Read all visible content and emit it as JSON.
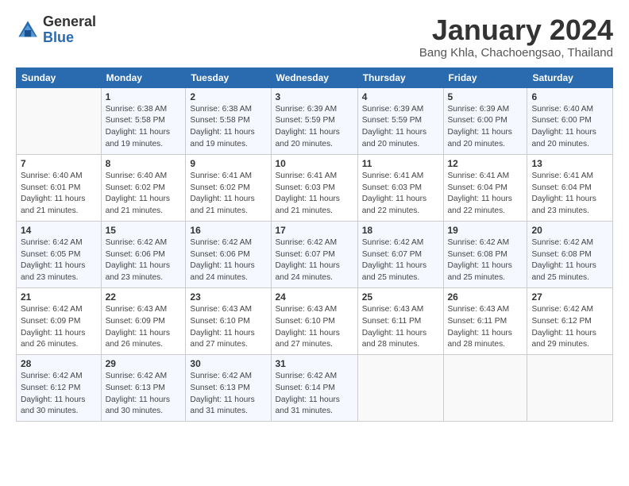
{
  "header": {
    "logo_general": "General",
    "logo_blue": "Blue",
    "month_title": "January 2024",
    "location": "Bang Khla, Chachoengsao, Thailand"
  },
  "weekdays": [
    "Sunday",
    "Monday",
    "Tuesday",
    "Wednesday",
    "Thursday",
    "Friday",
    "Saturday"
  ],
  "weeks": [
    [
      {
        "day": "",
        "info": ""
      },
      {
        "day": "1",
        "info": "Sunrise: 6:38 AM\nSunset: 5:58 PM\nDaylight: 11 hours and 19 minutes."
      },
      {
        "day": "2",
        "info": "Sunrise: 6:38 AM\nSunset: 5:58 PM\nDaylight: 11 hours and 19 minutes."
      },
      {
        "day": "3",
        "info": "Sunrise: 6:39 AM\nSunset: 5:59 PM\nDaylight: 11 hours and 20 minutes."
      },
      {
        "day": "4",
        "info": "Sunrise: 6:39 AM\nSunset: 5:59 PM\nDaylight: 11 hours and 20 minutes."
      },
      {
        "day": "5",
        "info": "Sunrise: 6:39 AM\nSunset: 6:00 PM\nDaylight: 11 hours and 20 minutes."
      },
      {
        "day": "6",
        "info": "Sunrise: 6:40 AM\nSunset: 6:00 PM\nDaylight: 11 hours and 20 minutes."
      }
    ],
    [
      {
        "day": "7",
        "info": "Sunrise: 6:40 AM\nSunset: 6:01 PM\nDaylight: 11 hours and 21 minutes."
      },
      {
        "day": "8",
        "info": "Sunrise: 6:40 AM\nSunset: 6:02 PM\nDaylight: 11 hours and 21 minutes."
      },
      {
        "day": "9",
        "info": "Sunrise: 6:41 AM\nSunset: 6:02 PM\nDaylight: 11 hours and 21 minutes."
      },
      {
        "day": "10",
        "info": "Sunrise: 6:41 AM\nSunset: 6:03 PM\nDaylight: 11 hours and 21 minutes."
      },
      {
        "day": "11",
        "info": "Sunrise: 6:41 AM\nSunset: 6:03 PM\nDaylight: 11 hours and 22 minutes."
      },
      {
        "day": "12",
        "info": "Sunrise: 6:41 AM\nSunset: 6:04 PM\nDaylight: 11 hours and 22 minutes."
      },
      {
        "day": "13",
        "info": "Sunrise: 6:41 AM\nSunset: 6:04 PM\nDaylight: 11 hours and 23 minutes."
      }
    ],
    [
      {
        "day": "14",
        "info": "Sunrise: 6:42 AM\nSunset: 6:05 PM\nDaylight: 11 hours and 23 minutes."
      },
      {
        "day": "15",
        "info": "Sunrise: 6:42 AM\nSunset: 6:06 PM\nDaylight: 11 hours and 23 minutes."
      },
      {
        "day": "16",
        "info": "Sunrise: 6:42 AM\nSunset: 6:06 PM\nDaylight: 11 hours and 24 minutes."
      },
      {
        "day": "17",
        "info": "Sunrise: 6:42 AM\nSunset: 6:07 PM\nDaylight: 11 hours and 24 minutes."
      },
      {
        "day": "18",
        "info": "Sunrise: 6:42 AM\nSunset: 6:07 PM\nDaylight: 11 hours and 25 minutes."
      },
      {
        "day": "19",
        "info": "Sunrise: 6:42 AM\nSunset: 6:08 PM\nDaylight: 11 hours and 25 minutes."
      },
      {
        "day": "20",
        "info": "Sunrise: 6:42 AM\nSunset: 6:08 PM\nDaylight: 11 hours and 25 minutes."
      }
    ],
    [
      {
        "day": "21",
        "info": "Sunrise: 6:42 AM\nSunset: 6:09 PM\nDaylight: 11 hours and 26 minutes."
      },
      {
        "day": "22",
        "info": "Sunrise: 6:43 AM\nSunset: 6:09 PM\nDaylight: 11 hours and 26 minutes."
      },
      {
        "day": "23",
        "info": "Sunrise: 6:43 AM\nSunset: 6:10 PM\nDaylight: 11 hours and 27 minutes."
      },
      {
        "day": "24",
        "info": "Sunrise: 6:43 AM\nSunset: 6:10 PM\nDaylight: 11 hours and 27 minutes."
      },
      {
        "day": "25",
        "info": "Sunrise: 6:43 AM\nSunset: 6:11 PM\nDaylight: 11 hours and 28 minutes."
      },
      {
        "day": "26",
        "info": "Sunrise: 6:43 AM\nSunset: 6:11 PM\nDaylight: 11 hours and 28 minutes."
      },
      {
        "day": "27",
        "info": "Sunrise: 6:42 AM\nSunset: 6:12 PM\nDaylight: 11 hours and 29 minutes."
      }
    ],
    [
      {
        "day": "28",
        "info": "Sunrise: 6:42 AM\nSunset: 6:12 PM\nDaylight: 11 hours and 30 minutes."
      },
      {
        "day": "29",
        "info": "Sunrise: 6:42 AM\nSunset: 6:13 PM\nDaylight: 11 hours and 30 minutes."
      },
      {
        "day": "30",
        "info": "Sunrise: 6:42 AM\nSunset: 6:13 PM\nDaylight: 11 hours and 31 minutes."
      },
      {
        "day": "31",
        "info": "Sunrise: 6:42 AM\nSunset: 6:14 PM\nDaylight: 11 hours and 31 minutes."
      },
      {
        "day": "",
        "info": ""
      },
      {
        "day": "",
        "info": ""
      },
      {
        "day": "",
        "info": ""
      }
    ]
  ]
}
